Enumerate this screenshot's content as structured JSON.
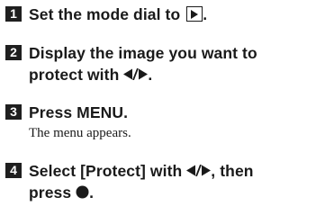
{
  "steps": [
    {
      "number": "1",
      "title_before_icon": "Set the mode dial to ",
      "title_icon": "playback-icon",
      "title_after_icon": "."
    },
    {
      "number": "2",
      "title_line1": "Display the image you want to",
      "title_line2_before_icon": "protect with ",
      "title_icon": "left-right-arrows-icon",
      "title_line2_after_icon": "."
    },
    {
      "number": "3",
      "title": "Press MENU.",
      "body": "The menu appears."
    },
    {
      "number": "4",
      "title_line1_before_icon": "Select [Protect] with ",
      "title_line1_icon": "left-right-arrows-icon",
      "title_line1_after_icon": ", then",
      "title_line2_before_icon": "press ",
      "title_line2_icon": "center-button-icon",
      "title_line2_after_icon": "."
    }
  ]
}
